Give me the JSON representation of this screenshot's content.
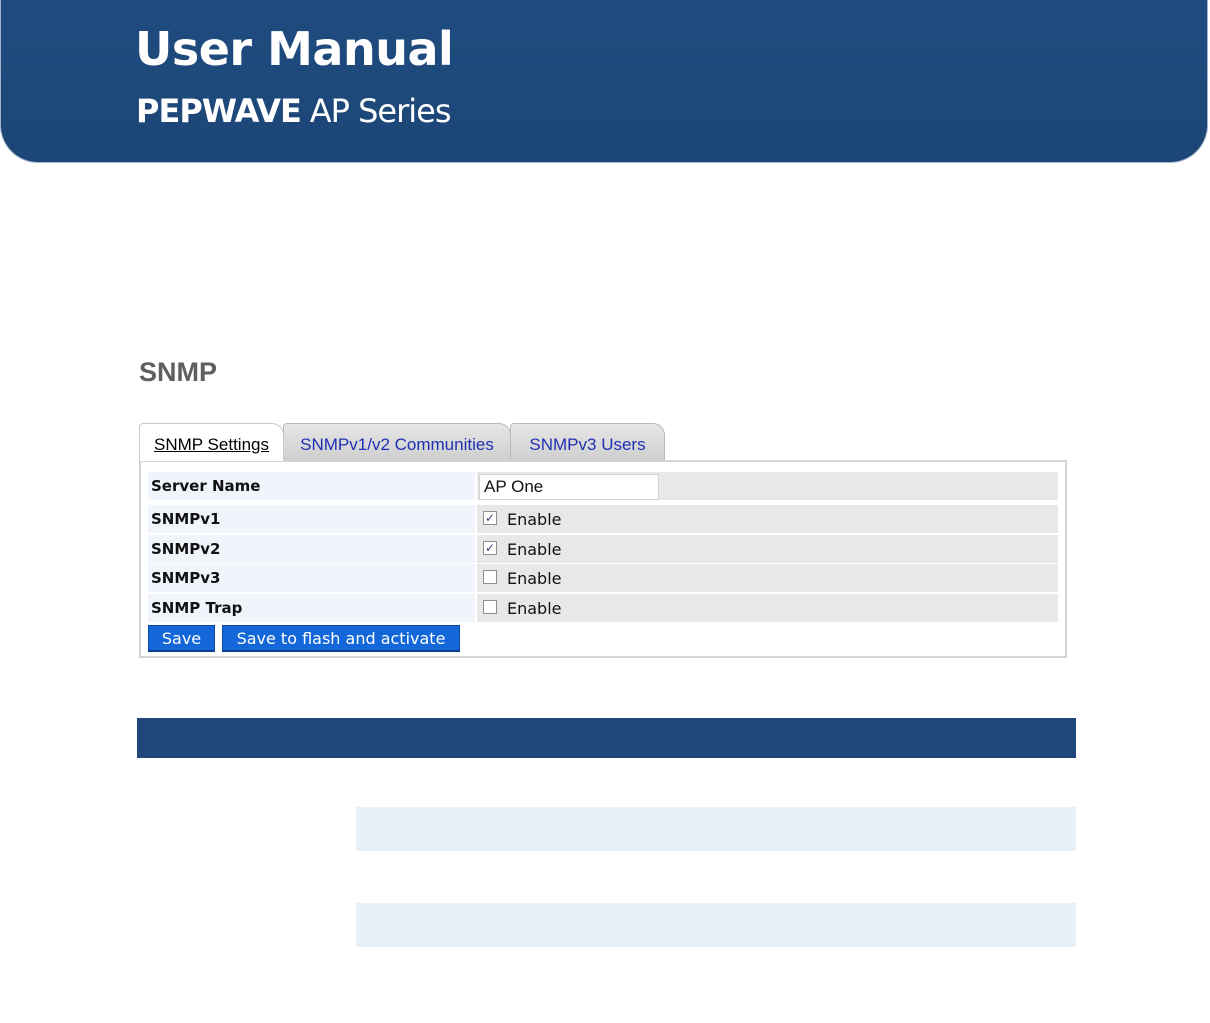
{
  "banner": {
    "title": "User Manual",
    "brand": "PEPWAVE",
    "series": "AP Series"
  },
  "page": {
    "section_title": "SNMP"
  },
  "tabs": [
    {
      "label": "SNMP Settings",
      "active": true
    },
    {
      "label": "SNMPv1/v2 Communities",
      "active": false
    },
    {
      "label": "SNMPv3 Users",
      "active": false
    }
  ],
  "form": {
    "server_name": {
      "label": "Server Name",
      "value": "AP One"
    },
    "snmpv1": {
      "label": "SNMPv1",
      "checked": true,
      "option": "Enable"
    },
    "snmpv2": {
      "label": "SNMPv2",
      "checked": true,
      "option": "Enable"
    },
    "snmpv3": {
      "label": "SNMPv3",
      "checked": false,
      "option": "Enable"
    },
    "snmp_trap": {
      "label": "SNMP Trap",
      "checked": false,
      "option": "Enable"
    }
  },
  "buttons": {
    "save": "Save",
    "save_activate": "Save to flash and activate"
  },
  "colors": {
    "banner": "#1f4b7f",
    "button": "#1467d9",
    "table_header": "#1f477a",
    "tab_link": "#1f2fb3"
  }
}
